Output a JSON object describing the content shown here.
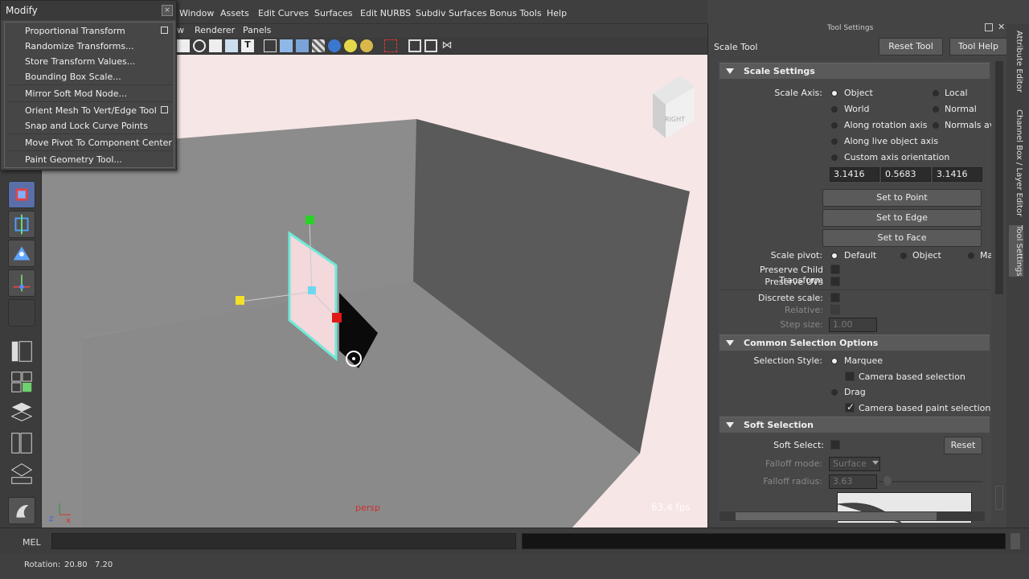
{
  "menubar": {
    "items": [
      "Window",
      "Assets",
      "Edit Curves",
      "Surfaces",
      "Edit NURBS",
      "Subdiv Surfaces",
      "Bonus Tools",
      "Help"
    ]
  },
  "modify_menu": {
    "title": "Modify",
    "close": "×",
    "items": [
      "Proportional Transform",
      "Randomize Transforms...",
      "Store Transform Values...",
      "Bounding Box Scale...",
      "Mirror Soft Mod Node...",
      "Orient Mesh To Vert/Edge Tool",
      "Snap and Lock Curve Points",
      "Move Pivot To Component Center",
      "Paint Geometry Tool..."
    ]
  },
  "viewport": {
    "menu": [
      "w",
      "Renderer",
      "Panels"
    ],
    "camera_label": "persp",
    "fps": "63.4 fps",
    "view_cube": "RIGHT"
  },
  "tool_settings": {
    "panel_title": "Tool Settings",
    "tool_name": "Scale Tool",
    "reset_button": "Reset Tool",
    "help_button": "Tool Help",
    "scale_settings": {
      "header": "Scale Settings",
      "axis_label": "Scale Axis:",
      "axis_options": [
        "Object",
        "Local",
        "World",
        "Normal",
        "Along rotation axis",
        "Normals ave",
        "Along live object axis",
        "Custom axis orientation"
      ],
      "axis_values": [
        "3.1416",
        "0.5683",
        "3.1416"
      ],
      "set_to_point": "Set to Point",
      "set_to_edge": "Set to Edge",
      "set_to_face": "Set to Face",
      "pivot_label": "Scale pivot:",
      "pivot_options": [
        "Default",
        "Object",
        "Ma"
      ],
      "preserve_child": "Preserve Child Transform",
      "preserve_uvs": "Preserve UVs",
      "discrete_scale": "Discrete scale:",
      "relative": "Relative:",
      "step_size": "Step size:",
      "step_value": "1.00"
    },
    "common_selection": {
      "header": "Common Selection Options",
      "style_label": "Selection Style:",
      "marquee": "Marquee",
      "camera_based_selection": "Camera based selection",
      "drag": "Drag",
      "camera_based_paint": "Camera based paint selection"
    },
    "soft_selection": {
      "header": "Soft Selection",
      "soft_select": "Soft Select:",
      "reset": "Reset",
      "falloff_mode_label": "Falloff mode:",
      "falloff_mode_value": "Surface",
      "falloff_radius_label": "Falloff radius:",
      "falloff_radius_value": "3.63"
    }
  },
  "side_tabs": [
    "Attribute Editor",
    "Channel Box / Layer Editor",
    "Tool Settings"
  ],
  "command_line": {
    "label": "MEL"
  },
  "help_line": {
    "label": "Rotation:",
    "value1": "20.80",
    "value2": "7.20"
  }
}
